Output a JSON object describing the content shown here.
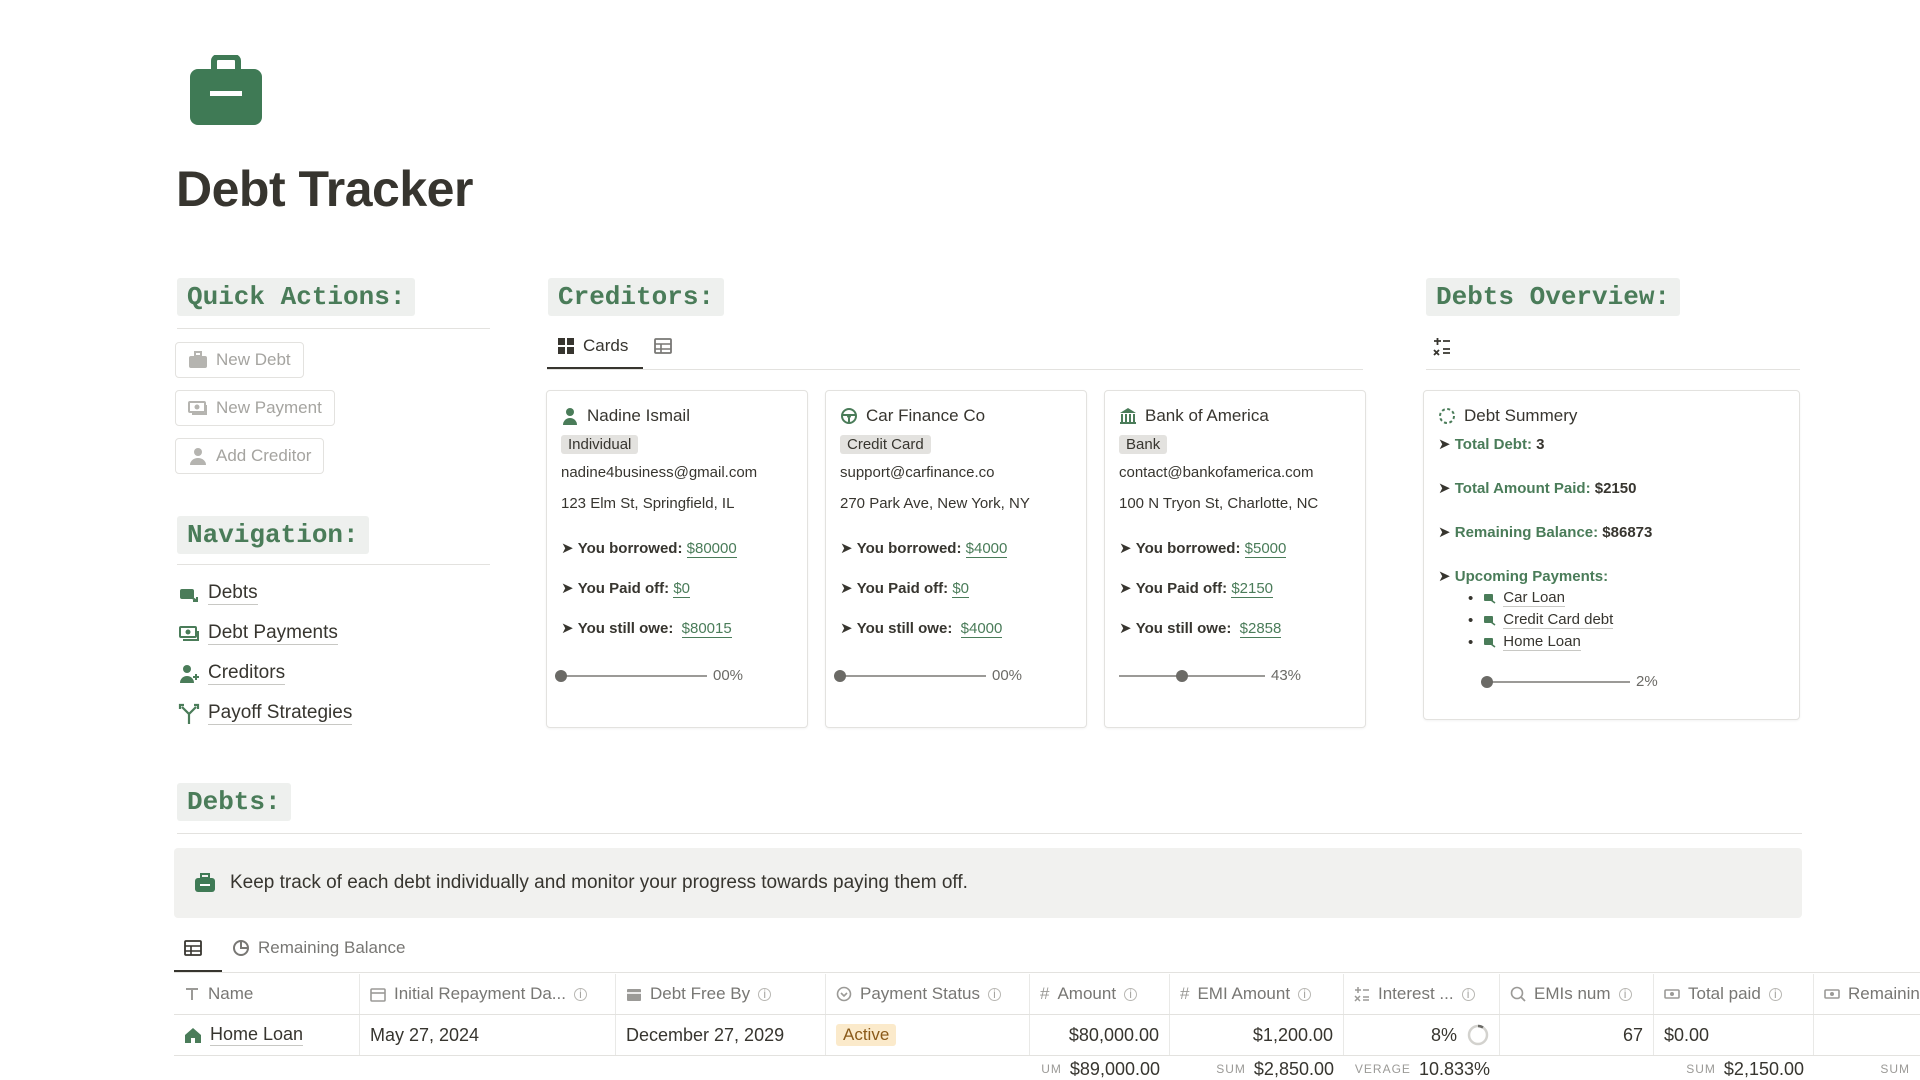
{
  "page": {
    "title": "Debt Tracker"
  },
  "colors": {
    "accent": "#4a7c59",
    "heading_bg": "#eef0ee",
    "status_active_bg": "#fbeacb"
  },
  "quick_actions": {
    "heading": "Quick Actions:",
    "buttons": [
      {
        "label": "New Debt",
        "icon": "briefcase-icon"
      },
      {
        "label": "New Payment",
        "icon": "money-icon"
      },
      {
        "label": "Add Creditor",
        "icon": "person-icon"
      }
    ]
  },
  "navigation": {
    "heading": "Navigation:",
    "items": [
      {
        "label": "Debts",
        "icon": "debt-icon"
      },
      {
        "label": "Debt Payments",
        "icon": "payment-icon"
      },
      {
        "label": "Creditors",
        "icon": "creditor-icon"
      },
      {
        "label": "Payoff Strategies",
        "icon": "strategy-icon"
      }
    ]
  },
  "creditors": {
    "heading": "Creditors:",
    "tabs": [
      {
        "label": "Cards",
        "icon": "grid-icon"
      },
      {
        "label": "",
        "icon": "table-icon"
      }
    ],
    "cards": [
      {
        "name": "Nadine Ismail",
        "icon": "person-icon",
        "type": "Individual",
        "email": "nadine4business@gmail.com",
        "address": "123 Elm St, Springfield, IL",
        "borrowed_label": "You borrowed:",
        "borrowed": "$80000",
        "paid_label": "You Paid off:",
        "paid": "$0",
        "owe_label": "You still owe:",
        "owe": "$80015",
        "progress": 0,
        "progress_text": "00%"
      },
      {
        "name": "Car Finance Co",
        "icon": "steering-wheel-icon",
        "type": "Credit Card",
        "email": "support@carfinance.co",
        "address": "270 Park Ave, New York, NY",
        "borrowed_label": "You borrowed:",
        "borrowed": "$4000",
        "paid_label": "You Paid off:",
        "paid": "$0",
        "owe_label": "You still owe:",
        "owe": "$4000",
        "progress": 0,
        "progress_text": "00%"
      },
      {
        "name": "Bank of America",
        "icon": "bank-icon",
        "type": "Bank",
        "email": "contact@bankofamerica.com",
        "address": "100 N Tryon St, Charlotte, NC",
        "borrowed_label": "You borrowed:",
        "borrowed": "$5000",
        "paid_label": "You Paid off:",
        "paid": "$2150",
        "owe_label": "You still owe:",
        "owe": "$2858",
        "progress": 0.43,
        "progress_text": "43%"
      }
    ]
  },
  "overview": {
    "heading": "Debts Overview:",
    "card_title": "Debt Summery",
    "total_debt_label": "Total Debt:",
    "total_debt": "3",
    "total_paid_label": "Total Amount Paid:",
    "total_paid": "$2150",
    "remaining_label": "Remaining Balance:",
    "remaining": "$86873",
    "upcoming_label": "Upcoming Payments:",
    "upcoming": [
      "Car Loan",
      "Credit Card debt",
      "Home Loan"
    ],
    "progress": 0.02,
    "progress_text": "2%"
  },
  "debts": {
    "heading": "Debts:",
    "callout": "Keep track of each debt individually and monitor your progress towards paying them off.",
    "view_tabs": [
      {
        "label": "",
        "icon": "table-icon"
      },
      {
        "label": "Remaining Balance",
        "icon": "pie-icon"
      }
    ],
    "columns": [
      "Name",
      "Initial Repayment Da...",
      "Debt Free By",
      "Payment Status",
      "Amount",
      "EMI Amount",
      "Interest ...",
      "EMIs num",
      "Total paid",
      "Remainin"
    ],
    "rows": [
      {
        "name": "Home Loan",
        "initial": "May 27, 2024",
        "free_by": "December 27, 2029",
        "status": "Active",
        "amount": "$80,000.00",
        "emi": "$1,200.00",
        "interest": "8%",
        "emis_num": "67",
        "total_paid": "$0.00"
      }
    ],
    "footer": {
      "amount_agg": "UM",
      "amount": "$89,000.00",
      "emi_agg": "SUM",
      "emi": "$2,850.00",
      "interest_agg": "VERAGE",
      "interest": "10.833%",
      "paid_agg": "SUM",
      "paid": "$2,150.00",
      "remaining_agg": "SUM"
    }
  }
}
